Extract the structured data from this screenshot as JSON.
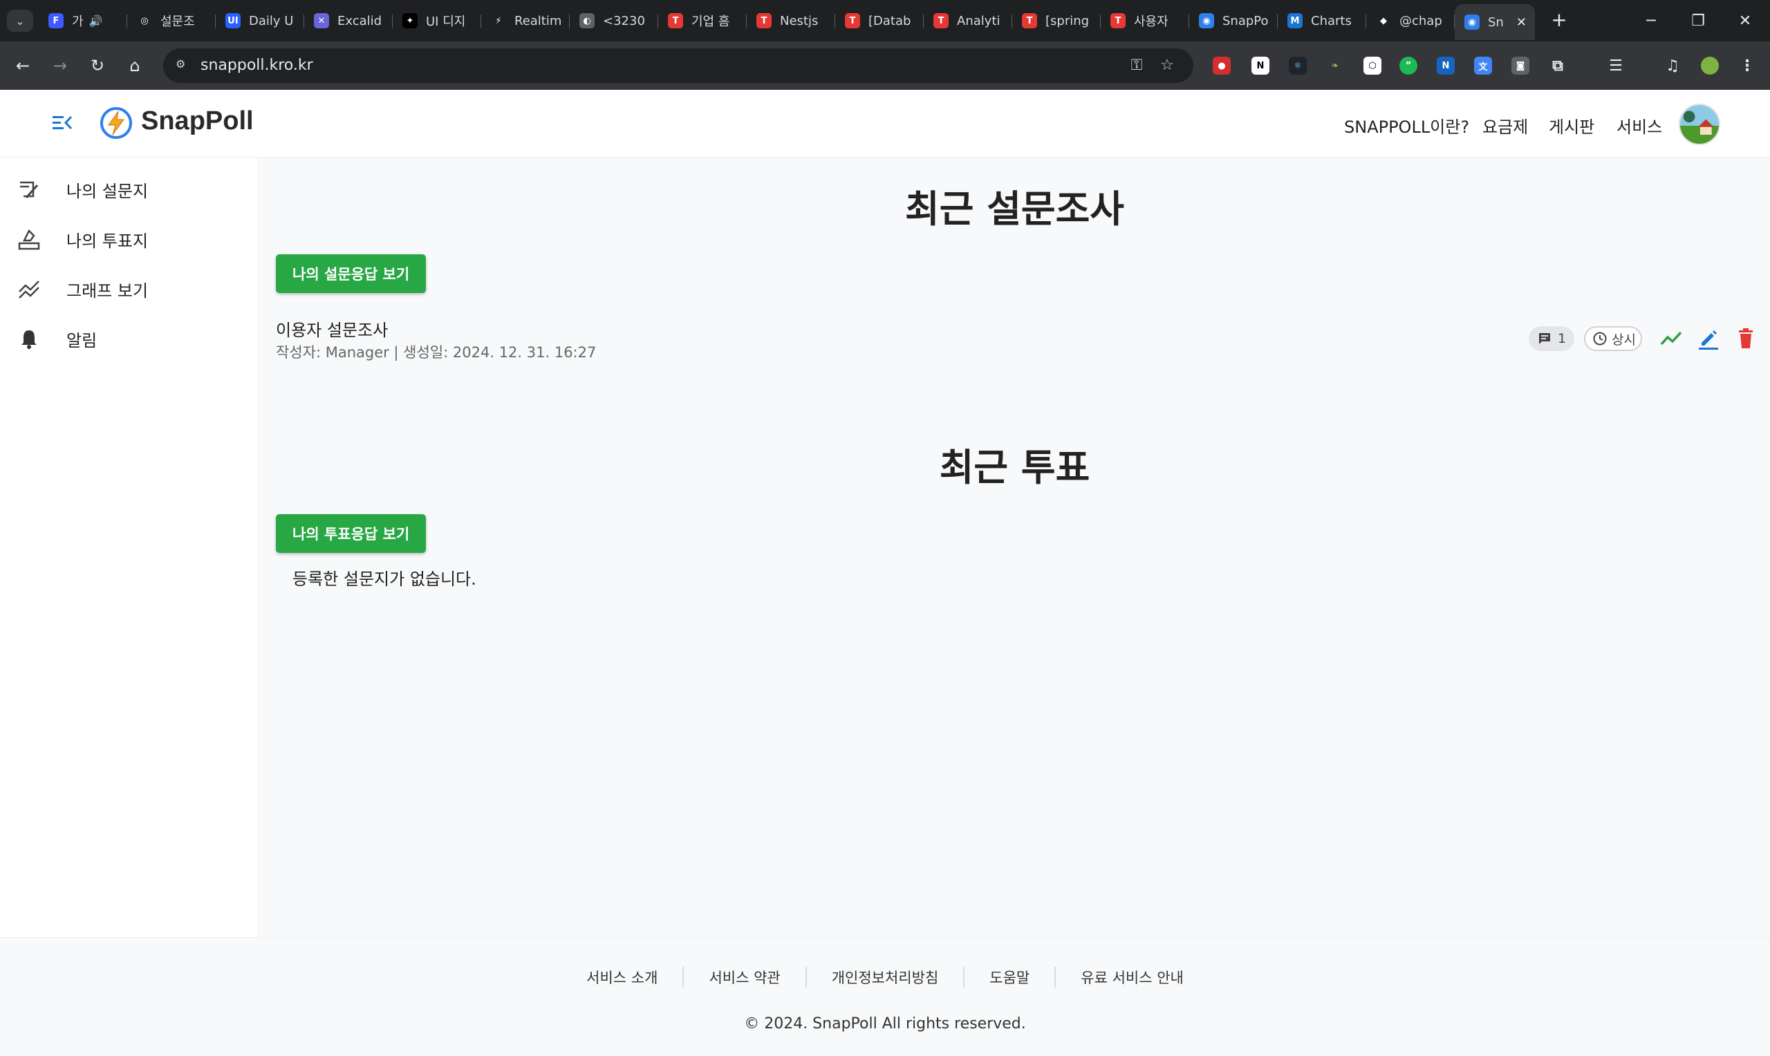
{
  "browser": {
    "tabs": [
      {
        "title": "가",
        "fav": "F",
        "fav_color": "#3d5afe",
        "audio": true
      },
      {
        "title": "설문조",
        "fav": "◎",
        "fav_color": "#1f2022"
      },
      {
        "title": "Daily U",
        "fav": "UI",
        "fav_color": "#2962ff"
      },
      {
        "title": "Excalid",
        "fav": "✕",
        "fav_color": "#6965db"
      },
      {
        "title": "UI 디지",
        "fav": "✦",
        "fav_color": "#000000"
      },
      {
        "title": "Realtim",
        "fav": "⚡",
        "fav_color": "#1f2022"
      },
      {
        "title": "<3230",
        "fav": "◐",
        "fav_color": "#5f6368"
      },
      {
        "title": "기업 흠",
        "fav": "T",
        "fav_color": "#e53935"
      },
      {
        "title": "Nestjs",
        "fav": "T",
        "fav_color": "#e53935"
      },
      {
        "title": "[Datab",
        "fav": "T",
        "fav_color": "#e53935"
      },
      {
        "title": "Analyti",
        "fav": "T",
        "fav_color": "#e53935"
      },
      {
        "title": "[spring",
        "fav": "T",
        "fav_color": "#e53935"
      },
      {
        "title": "사용자",
        "fav": "T",
        "fav_color": "#e53935"
      },
      {
        "title": "SnapPo",
        "fav": "◉",
        "fav_color": "#2f80ed"
      },
      {
        "title": "Charts",
        "fav": "M",
        "fav_color": "#1976d2"
      },
      {
        "title": "@chap",
        "fav": "◆",
        "fav_color": "#1f2022"
      },
      {
        "title": "Sn",
        "fav": "◉",
        "fav_color": "#2f80ed",
        "active": true
      }
    ],
    "url": "snappoll.kro.kr"
  },
  "header": {
    "brand": "SnapPoll",
    "nav": [
      "SNAPPOLL이란?",
      "요금제",
      "게시판",
      "서비스"
    ]
  },
  "sidebar": {
    "items": [
      {
        "label": "나의 설문지",
        "icon": "survey-icon"
      },
      {
        "label": "나의 투표지",
        "icon": "vote-icon"
      },
      {
        "label": "그래프 보기",
        "icon": "graph-icon"
      },
      {
        "label": "알림",
        "icon": "bell-icon"
      }
    ]
  },
  "main": {
    "survey_section": {
      "title": "최근 설문조사",
      "button": "나의 설문응답 보기",
      "item": {
        "title": "이용자 설문조사",
        "meta": "작성자: Manager | 생성일: 2024. 12. 31. 16:27",
        "comment_count": "1",
        "status": "상시"
      }
    },
    "vote_section": {
      "title": "최근 투표",
      "button": "나의 투표응답 보기",
      "empty": "등록한 설문지가 없습니다."
    }
  },
  "footer": {
    "links": [
      "서비스 소개",
      "서비스 약관",
      "개인정보처리방침",
      "도움말",
      "유료 서비스 안내"
    ],
    "copyright": "© 2024. SnapPoll All rights reserved."
  },
  "colors": {
    "primary_green": "#28a745",
    "accent_blue": "#1976d2",
    "danger_red": "#e53935"
  }
}
